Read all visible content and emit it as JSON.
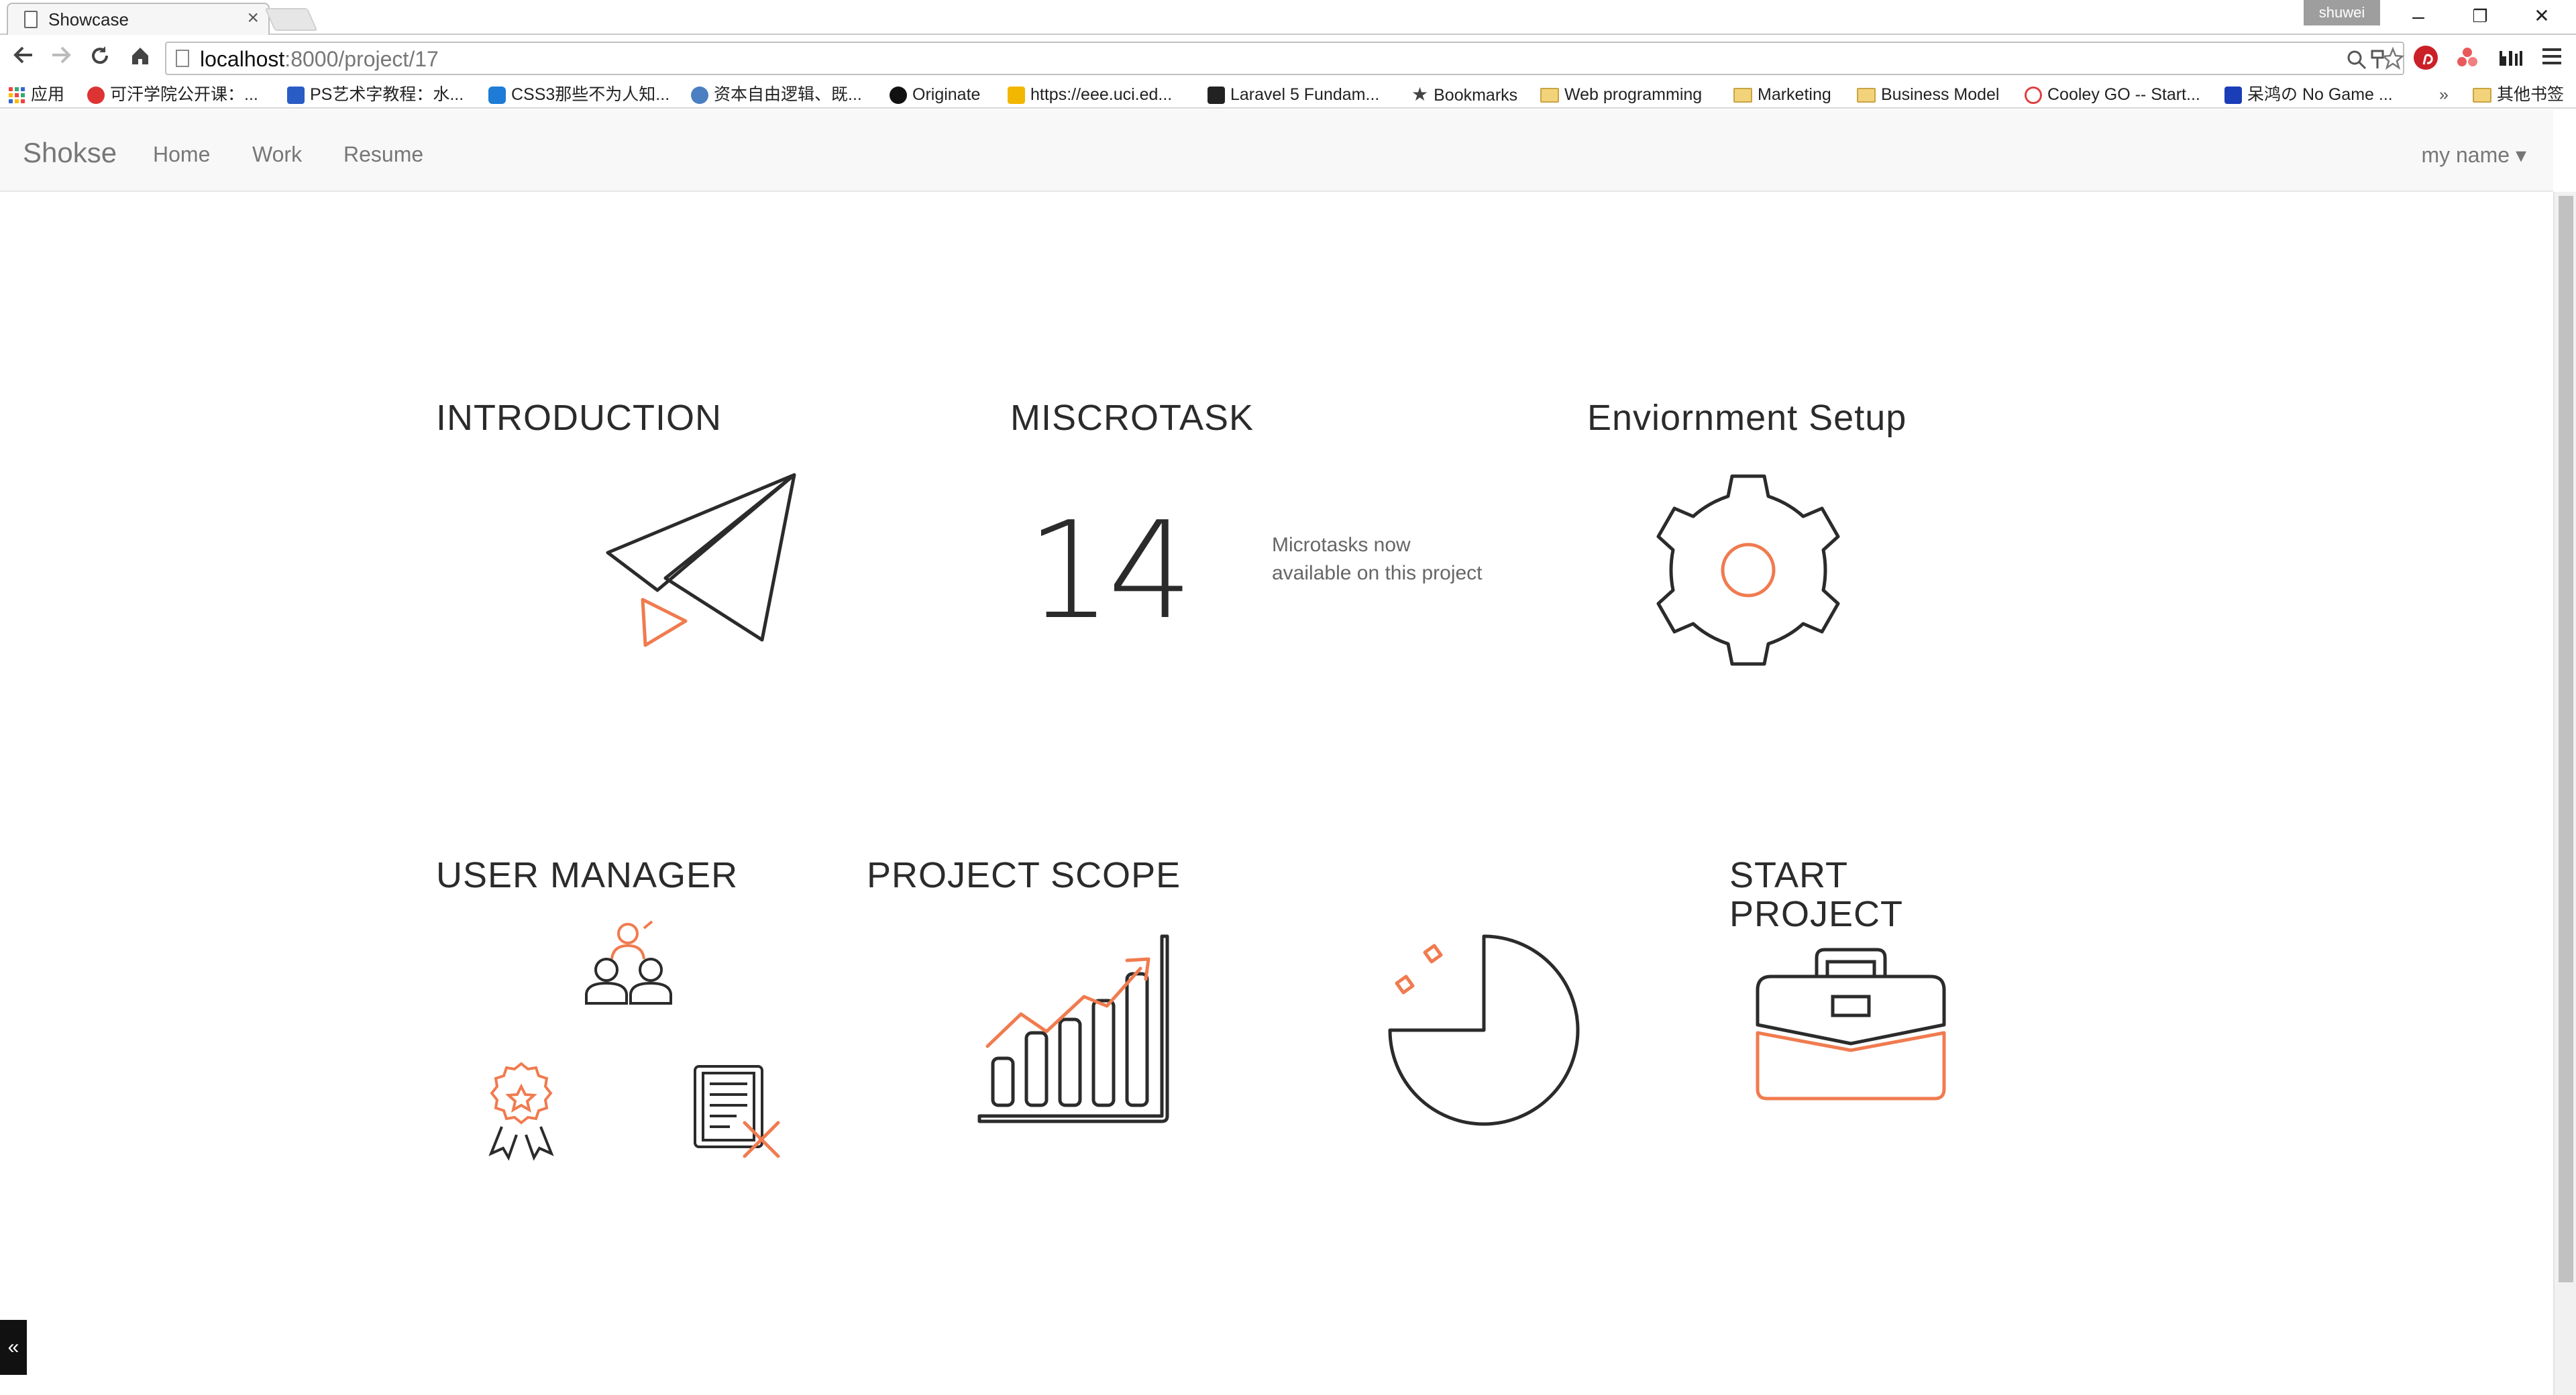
{
  "browser": {
    "tab_title": "Showcase",
    "tab_close": "×",
    "profile": "shuwei",
    "window_controls": {
      "minimize": "–",
      "restore": "❐",
      "close": "✕"
    },
    "url_host": "localhost",
    "url_path": ":8000/project/17",
    "bookmarks": [
      {
        "label": "应用",
        "icon": "apps-grid-icon"
      },
      {
        "label": "可汗学院公开课：...",
        "icon": "netease-icon"
      },
      {
        "label": "PS艺术字教程：水...",
        "icon": "baidu-icon"
      },
      {
        "label": "CSS3那些不为人知...",
        "icon": "blog-icon"
      },
      {
        "label": "资本自由逻辑、既...",
        "icon": "news-icon"
      },
      {
        "label": "Originate",
        "icon": "originate-icon"
      },
      {
        "label": "https://eee.uci.ed...",
        "icon": "uci-icon"
      },
      {
        "label": "Laravel 5 Fundam...",
        "icon": "laravel-icon"
      },
      {
        "label": "Bookmarks",
        "icon": "star-icon"
      },
      {
        "label": "Web programming",
        "icon": "folder-icon"
      },
      {
        "label": "Marketing",
        "icon": "folder-icon"
      },
      {
        "label": "Business Model",
        "icon": "folder-icon"
      },
      {
        "label": "Cooley GO -- Start...",
        "icon": "cooley-icon"
      },
      {
        "label": "呆鸿の No Game ...",
        "icon": "blog-icon"
      }
    ],
    "bookmarks_overflow": "»",
    "other_bookmarks": "其他书签"
  },
  "site": {
    "brand": "Shokse",
    "nav": [
      "Home",
      "Work",
      "Resume"
    ],
    "user_menu": "my name ▾"
  },
  "sections": {
    "introduction": "INTRODUCTION",
    "microtask": "MISCROTASK",
    "microtask_count": "14",
    "microtask_note_1": "Microtasks now",
    "microtask_note_2": "available on this project",
    "environment": "Enviornment Setup",
    "user_manager": "USER MANAGER",
    "project_scope": "PROJECT SCOPE",
    "start_project_1": "START",
    "start_project_2": "PROJECT"
  },
  "colors": {
    "accent": "#f07b4f",
    "line": "#2b2b2b"
  },
  "corner_toggle": "«"
}
